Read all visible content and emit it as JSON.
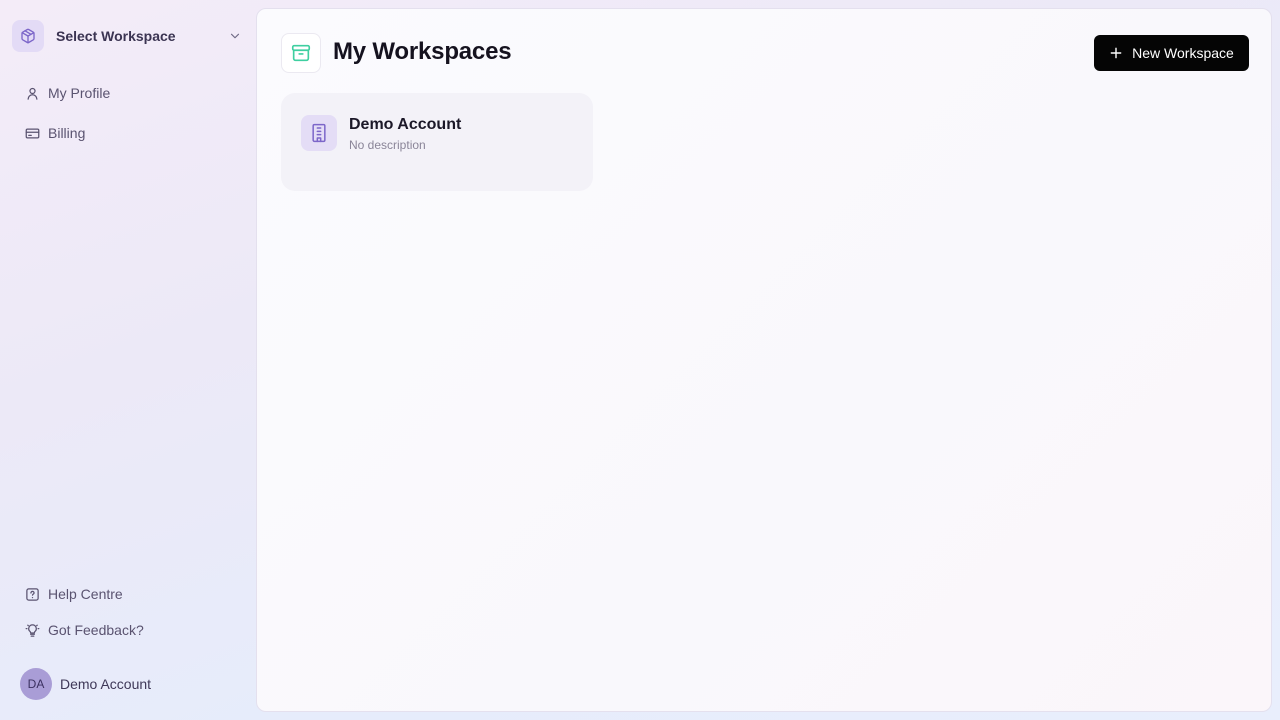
{
  "sidebar": {
    "workspace_select": {
      "label": "Select Workspace",
      "icon": "box-icon"
    },
    "nav_top": [
      {
        "label": "My Profile",
        "icon": "user-icon"
      },
      {
        "label": "Billing",
        "icon": "credit-card-icon"
      }
    ],
    "nav_bottom": [
      {
        "label": "Help Centre",
        "icon": "help-icon"
      },
      {
        "label": "Got Feedback?",
        "icon": "lightbulb-icon"
      }
    ],
    "user": {
      "initials": "DA",
      "name": "Demo Account"
    }
  },
  "main": {
    "title": "My Workspaces",
    "title_icon": "archive-box-icon",
    "new_button_label": "New Workspace",
    "workspaces": [
      {
        "name": "Demo Account",
        "description": "No description",
        "icon": "building-icon"
      }
    ]
  },
  "colors": {
    "accent_purple": "#7c66c9",
    "accent_teal": "#3ecfa0",
    "button_bg": "#050505"
  }
}
